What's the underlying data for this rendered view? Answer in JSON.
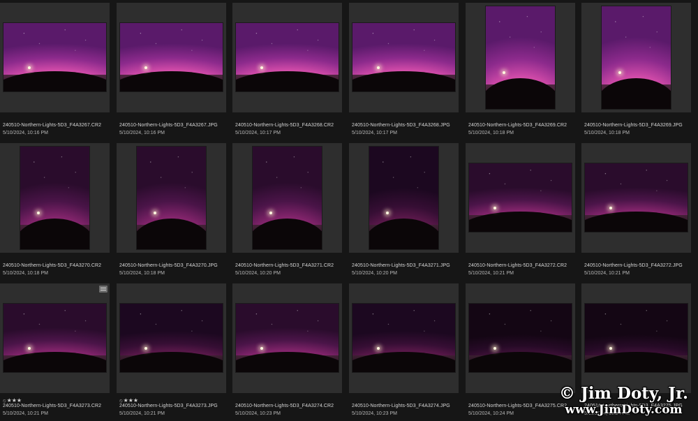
{
  "thumbnails": [
    {
      "filename": "240510-Northern-Lights-5D3_F4A3267.CR2",
      "date": "5/10/2024, 10:16 PM",
      "rating": "",
      "orientation": "landscape",
      "brightness": "bright"
    },
    {
      "filename": "240510-Northern-Lights-5D3_F4A3267.JPG",
      "date": "5/10/2024, 10:16 PM",
      "rating": "",
      "orientation": "landscape",
      "brightness": "bright"
    },
    {
      "filename": "240510-Northern-Lights-5D3_F4A3268.CR2",
      "date": "5/10/2024, 10:17 PM",
      "rating": "",
      "orientation": "landscape",
      "brightness": "bright"
    },
    {
      "filename": "240510-Northern-Lights-5D3_F4A3268.JPG",
      "date": "5/10/2024, 10:17 PM",
      "rating": "",
      "orientation": "landscape",
      "brightness": "bright"
    },
    {
      "filename": "240510-Northern-Lights-5D3_F4A3269.CR2",
      "date": "5/10/2024, 10:18 PM",
      "rating": "",
      "orientation": "portrait",
      "brightness": "bright"
    },
    {
      "filename": "240510-Northern-Lights-5D3_F4A3269.JPG",
      "date": "5/10/2024, 10:18 PM",
      "rating": "",
      "orientation": "portrait",
      "brightness": "bright"
    },
    {
      "filename": "240510-Northern-Lights-5D3_F4A3270.CR2",
      "date": "5/10/2024, 10:18 PM",
      "rating": "",
      "orientation": "portrait",
      "brightness": "mid"
    },
    {
      "filename": "240510-Northern-Lights-5D3_F4A3270.JPG",
      "date": "5/10/2024, 10:18 PM",
      "rating": "",
      "orientation": "portrait",
      "brightness": "mid"
    },
    {
      "filename": "240510-Northern-Lights-5D3_F4A3271.CR2",
      "date": "5/10/2024, 10:20 PM",
      "rating": "",
      "orientation": "portrait",
      "brightness": "mid"
    },
    {
      "filename": "240510-Northern-Lights-5D3_F4A3271.JPG",
      "date": "5/10/2024, 10:20 PM",
      "rating": "",
      "orientation": "portrait",
      "brightness": "dark"
    },
    {
      "filename": "240510-Northern-Lights-5D3_F4A3272.CR2",
      "date": "5/10/2024, 10:21 PM",
      "rating": "",
      "orientation": "landscape",
      "brightness": "mid"
    },
    {
      "filename": "240510-Northern-Lights-5D3_F4A3272.JPG",
      "date": "5/10/2024, 10:21 PM",
      "rating": "",
      "orientation": "landscape",
      "brightness": "mid"
    },
    {
      "filename": "240510-Northern-Lights-5D3_F4A3273.CR2",
      "date": "5/10/2024, 10:21 PM",
      "rating": "★★★",
      "orientation": "landscape",
      "brightness": "mid",
      "badge": true
    },
    {
      "filename": "240510-Northern-Lights-5D3_F4A3273.JPG",
      "date": "5/10/2024, 10:21 PM",
      "rating": "★★★",
      "orientation": "landscape",
      "brightness": "dark"
    },
    {
      "filename": "240510-Northern-Lights-5D3_F4A3274.CR2",
      "date": "5/10/2024, 10:23 PM",
      "rating": "",
      "orientation": "landscape",
      "brightness": "mid"
    },
    {
      "filename": "240510-Northern-Lights-5D3_F4A3274.JPG",
      "date": "5/10/2024, 10:23 PM",
      "rating": "",
      "orientation": "landscape",
      "brightness": "dark"
    },
    {
      "filename": "240510-Northern-Lights-5D3_F4A3275.CR2",
      "date": "5/10/2024, 10:24 PM",
      "rating": "",
      "orientation": "landscape",
      "brightness": "darker"
    },
    {
      "filename": "240510-Northern-Lights-5D3_F4A3275.JPG",
      "date": "5/10/2024, 10:24 PM",
      "rating": "",
      "orientation": "landscape",
      "brightness": "darker"
    }
  ],
  "watermark": {
    "line1": "© Jim Doty, Jr.",
    "line2": "www.JimDoty.com"
  },
  "icons": {
    "rating_flag": "reject-flag-icon",
    "edit_badge": "adjustments-badge-icon"
  },
  "colors": {
    "background": "#161616",
    "thumb_panel": "#2e2e2e"
  }
}
